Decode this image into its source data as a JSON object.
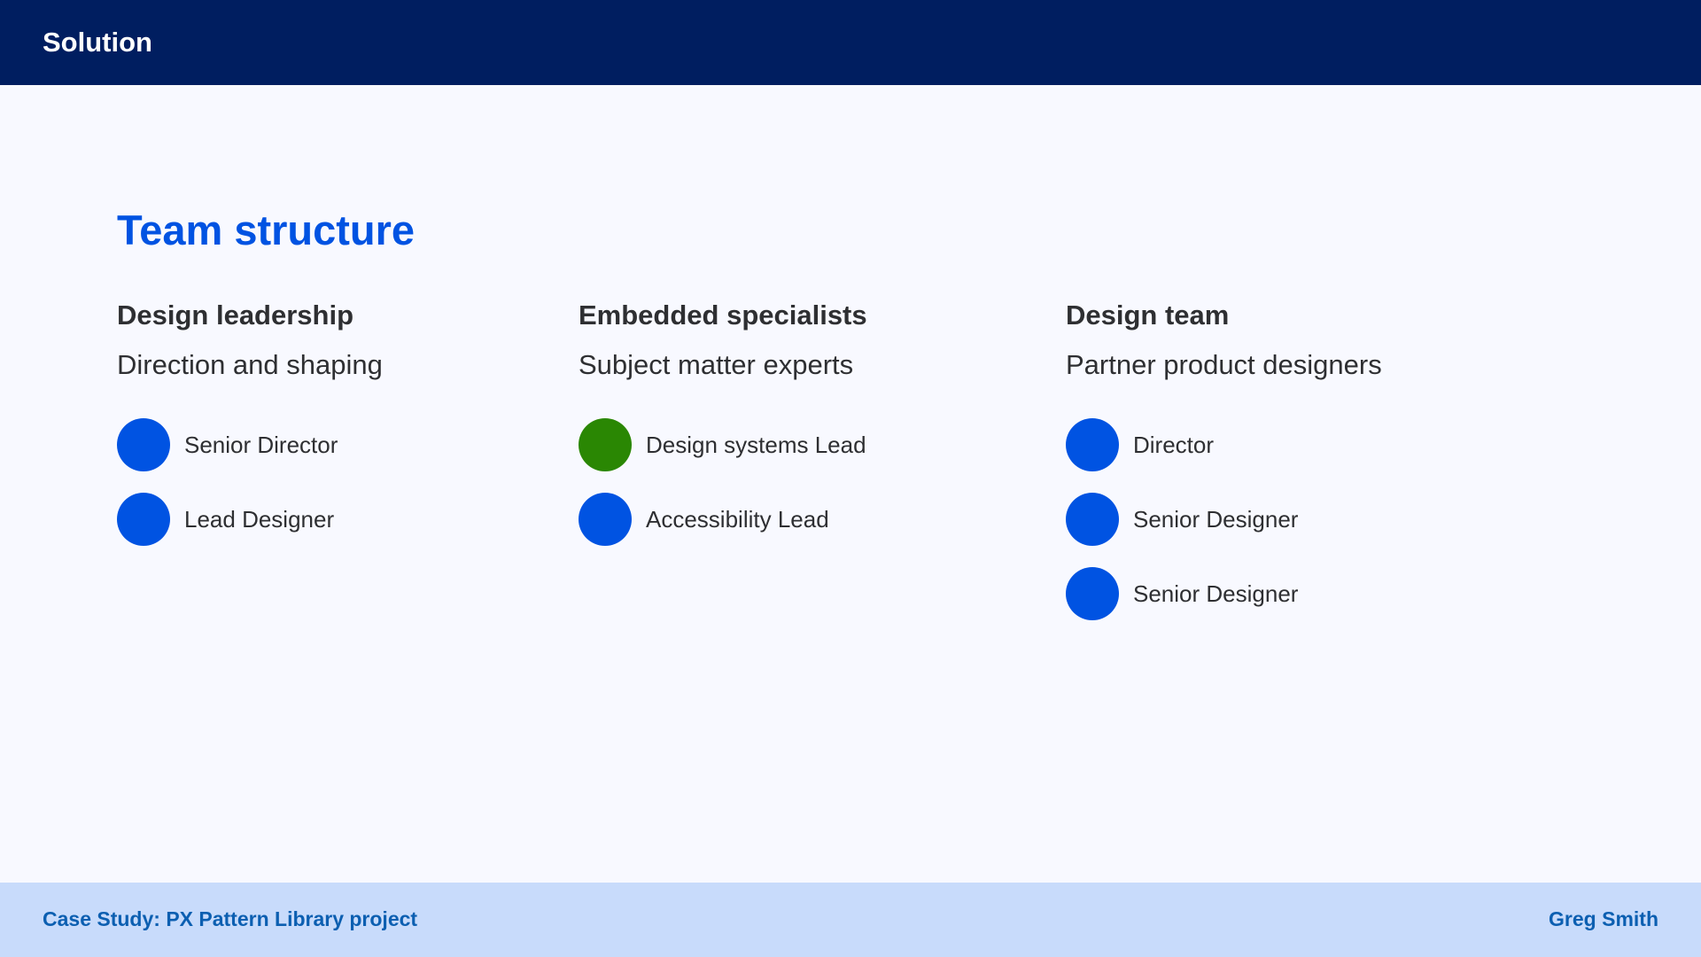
{
  "header": {
    "title": "Solution"
  },
  "page": {
    "title": "Team structure"
  },
  "columns": [
    {
      "heading": "Design leadership",
      "subheading": "Direction and shaping",
      "members": [
        {
          "name": "Senior Director",
          "color": "#0053e2"
        },
        {
          "name": "Lead Designer",
          "color": "#0053e2"
        }
      ]
    },
    {
      "heading": "Embedded specialists",
      "subheading": "Subject matter experts",
      "members": [
        {
          "name": "Design systems Lead",
          "color": "#2a8703"
        },
        {
          "name": "Accessibility Lead",
          "color": "#0053e2"
        }
      ]
    },
    {
      "heading": "Design team",
      "subheading": "Partner product designers",
      "members": [
        {
          "name": "Director",
          "color": "#0053e2"
        },
        {
          "name": "Senior Designer",
          "color": "#0053e2"
        },
        {
          "name": "Senior Designer",
          "color": "#0053e2"
        }
      ]
    }
  ],
  "footer": {
    "left_text": "Case Study: PX Pattern Library project",
    "right_text": "Greg Smith"
  }
}
